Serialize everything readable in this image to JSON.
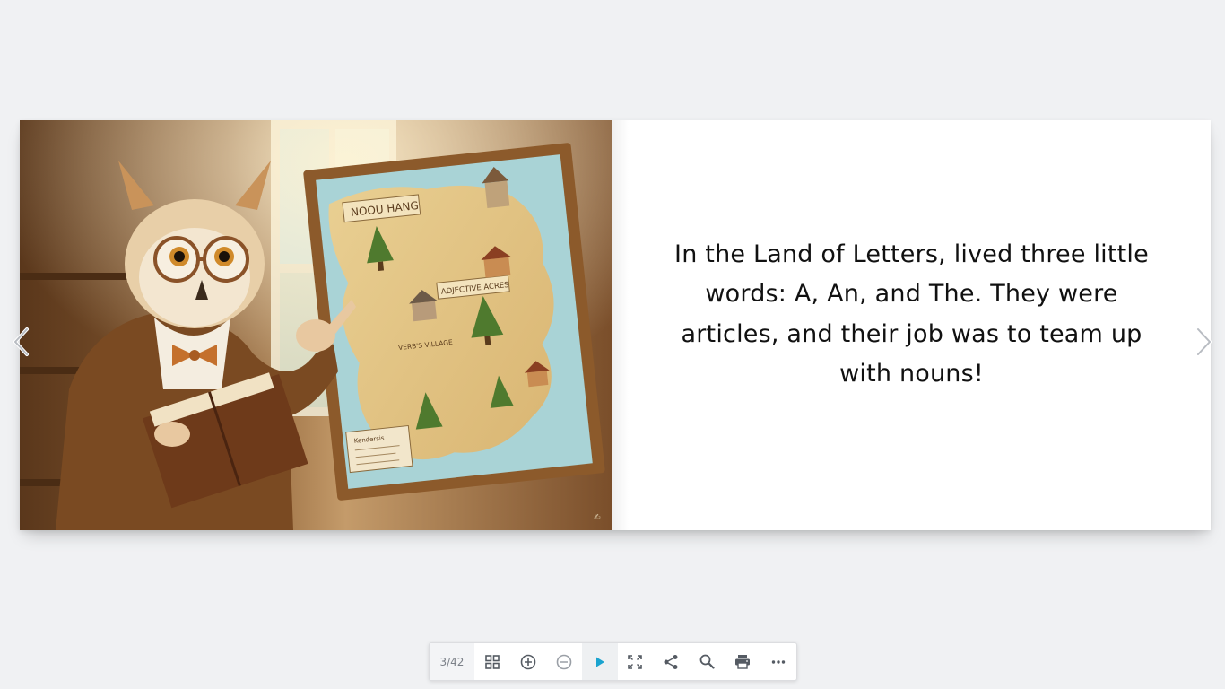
{
  "viewer": {
    "page_indicator": "3/42"
  },
  "pages": {
    "right": {
      "story_text": "In the Land of Letters, lived three little words: A, An, and The. They were articles, and their job was to team up with nouns!"
    },
    "left": {
      "illustration": {
        "map_title": "NOOU HANG",
        "map_labels": [
          "ADJECTIVE ACRES",
          "VERB'S VILLAGE"
        ],
        "legend_title": "Kendersis"
      }
    }
  },
  "navigation": {
    "prev_icon": "chevron-left-icon",
    "next_icon": "chevron-right-icon"
  },
  "toolbar": {
    "buttons": [
      {
        "icon": "grid-view-icon"
      },
      {
        "icon": "zoom-in-icon"
      },
      {
        "icon": "zoom-out-icon"
      },
      {
        "icon": "play-icon",
        "active": true
      },
      {
        "icon": "fullscreen-icon"
      },
      {
        "icon": "share-icon"
      },
      {
        "icon": "search-icon"
      },
      {
        "icon": "print-icon"
      },
      {
        "icon": "more-icon"
      }
    ]
  },
  "colors": {
    "background": "#f0f1f3",
    "accent": "#1aa3cf",
    "icon": "#555b63"
  }
}
